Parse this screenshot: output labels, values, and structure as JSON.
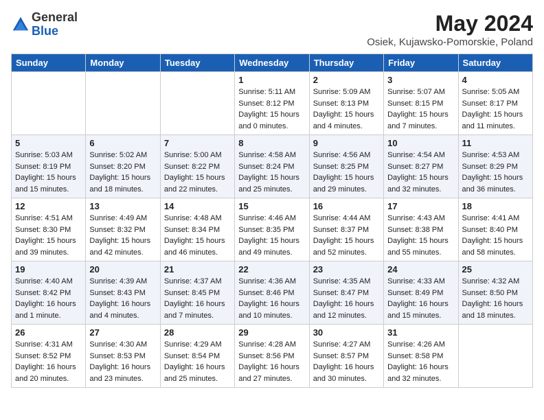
{
  "header": {
    "logo_general": "General",
    "logo_blue": "Blue",
    "month_year": "May 2024",
    "location": "Osiek, Kujawsko-Pomorskie, Poland"
  },
  "weekdays": [
    "Sunday",
    "Monday",
    "Tuesday",
    "Wednesday",
    "Thursday",
    "Friday",
    "Saturday"
  ],
  "weeks": [
    [
      {
        "day": "",
        "sunrise": "",
        "sunset": "",
        "daylight": ""
      },
      {
        "day": "",
        "sunrise": "",
        "sunset": "",
        "daylight": ""
      },
      {
        "day": "",
        "sunrise": "",
        "sunset": "",
        "daylight": ""
      },
      {
        "day": "1",
        "sunrise": "Sunrise: 5:11 AM",
        "sunset": "Sunset: 8:12 PM",
        "daylight": "Daylight: 15 hours and 0 minutes."
      },
      {
        "day": "2",
        "sunrise": "Sunrise: 5:09 AM",
        "sunset": "Sunset: 8:13 PM",
        "daylight": "Daylight: 15 hours and 4 minutes."
      },
      {
        "day": "3",
        "sunrise": "Sunrise: 5:07 AM",
        "sunset": "Sunset: 8:15 PM",
        "daylight": "Daylight: 15 hours and 7 minutes."
      },
      {
        "day": "4",
        "sunrise": "Sunrise: 5:05 AM",
        "sunset": "Sunset: 8:17 PM",
        "daylight": "Daylight: 15 hours and 11 minutes."
      }
    ],
    [
      {
        "day": "5",
        "sunrise": "Sunrise: 5:03 AM",
        "sunset": "Sunset: 8:19 PM",
        "daylight": "Daylight: 15 hours and 15 minutes."
      },
      {
        "day": "6",
        "sunrise": "Sunrise: 5:02 AM",
        "sunset": "Sunset: 8:20 PM",
        "daylight": "Daylight: 15 hours and 18 minutes."
      },
      {
        "day": "7",
        "sunrise": "Sunrise: 5:00 AM",
        "sunset": "Sunset: 8:22 PM",
        "daylight": "Daylight: 15 hours and 22 minutes."
      },
      {
        "day": "8",
        "sunrise": "Sunrise: 4:58 AM",
        "sunset": "Sunset: 8:24 PM",
        "daylight": "Daylight: 15 hours and 25 minutes."
      },
      {
        "day": "9",
        "sunrise": "Sunrise: 4:56 AM",
        "sunset": "Sunset: 8:25 PM",
        "daylight": "Daylight: 15 hours and 29 minutes."
      },
      {
        "day": "10",
        "sunrise": "Sunrise: 4:54 AM",
        "sunset": "Sunset: 8:27 PM",
        "daylight": "Daylight: 15 hours and 32 minutes."
      },
      {
        "day": "11",
        "sunrise": "Sunrise: 4:53 AM",
        "sunset": "Sunset: 8:29 PM",
        "daylight": "Daylight: 15 hours and 36 minutes."
      }
    ],
    [
      {
        "day": "12",
        "sunrise": "Sunrise: 4:51 AM",
        "sunset": "Sunset: 8:30 PM",
        "daylight": "Daylight: 15 hours and 39 minutes."
      },
      {
        "day": "13",
        "sunrise": "Sunrise: 4:49 AM",
        "sunset": "Sunset: 8:32 PM",
        "daylight": "Daylight: 15 hours and 42 minutes."
      },
      {
        "day": "14",
        "sunrise": "Sunrise: 4:48 AM",
        "sunset": "Sunset: 8:34 PM",
        "daylight": "Daylight: 15 hours and 46 minutes."
      },
      {
        "day": "15",
        "sunrise": "Sunrise: 4:46 AM",
        "sunset": "Sunset: 8:35 PM",
        "daylight": "Daylight: 15 hours and 49 minutes."
      },
      {
        "day": "16",
        "sunrise": "Sunrise: 4:44 AM",
        "sunset": "Sunset: 8:37 PM",
        "daylight": "Daylight: 15 hours and 52 minutes."
      },
      {
        "day": "17",
        "sunrise": "Sunrise: 4:43 AM",
        "sunset": "Sunset: 8:38 PM",
        "daylight": "Daylight: 15 hours and 55 minutes."
      },
      {
        "day": "18",
        "sunrise": "Sunrise: 4:41 AM",
        "sunset": "Sunset: 8:40 PM",
        "daylight": "Daylight: 15 hours and 58 minutes."
      }
    ],
    [
      {
        "day": "19",
        "sunrise": "Sunrise: 4:40 AM",
        "sunset": "Sunset: 8:42 PM",
        "daylight": "Daylight: 16 hours and 1 minute."
      },
      {
        "day": "20",
        "sunrise": "Sunrise: 4:39 AM",
        "sunset": "Sunset: 8:43 PM",
        "daylight": "Daylight: 16 hours and 4 minutes."
      },
      {
        "day": "21",
        "sunrise": "Sunrise: 4:37 AM",
        "sunset": "Sunset: 8:45 PM",
        "daylight": "Daylight: 16 hours and 7 minutes."
      },
      {
        "day": "22",
        "sunrise": "Sunrise: 4:36 AM",
        "sunset": "Sunset: 8:46 PM",
        "daylight": "Daylight: 16 hours and 10 minutes."
      },
      {
        "day": "23",
        "sunrise": "Sunrise: 4:35 AM",
        "sunset": "Sunset: 8:47 PM",
        "daylight": "Daylight: 16 hours and 12 minutes."
      },
      {
        "day": "24",
        "sunrise": "Sunrise: 4:33 AM",
        "sunset": "Sunset: 8:49 PM",
        "daylight": "Daylight: 16 hours and 15 minutes."
      },
      {
        "day": "25",
        "sunrise": "Sunrise: 4:32 AM",
        "sunset": "Sunset: 8:50 PM",
        "daylight": "Daylight: 16 hours and 18 minutes."
      }
    ],
    [
      {
        "day": "26",
        "sunrise": "Sunrise: 4:31 AM",
        "sunset": "Sunset: 8:52 PM",
        "daylight": "Daylight: 16 hours and 20 minutes."
      },
      {
        "day": "27",
        "sunrise": "Sunrise: 4:30 AM",
        "sunset": "Sunset: 8:53 PM",
        "daylight": "Daylight: 16 hours and 23 minutes."
      },
      {
        "day": "28",
        "sunrise": "Sunrise: 4:29 AM",
        "sunset": "Sunset: 8:54 PM",
        "daylight": "Daylight: 16 hours and 25 minutes."
      },
      {
        "day": "29",
        "sunrise": "Sunrise: 4:28 AM",
        "sunset": "Sunset: 8:56 PM",
        "daylight": "Daylight: 16 hours and 27 minutes."
      },
      {
        "day": "30",
        "sunrise": "Sunrise: 4:27 AM",
        "sunset": "Sunset: 8:57 PM",
        "daylight": "Daylight: 16 hours and 30 minutes."
      },
      {
        "day": "31",
        "sunrise": "Sunrise: 4:26 AM",
        "sunset": "Sunset: 8:58 PM",
        "daylight": "Daylight: 16 hours and 32 minutes."
      },
      {
        "day": "",
        "sunrise": "",
        "sunset": "",
        "daylight": ""
      }
    ]
  ]
}
